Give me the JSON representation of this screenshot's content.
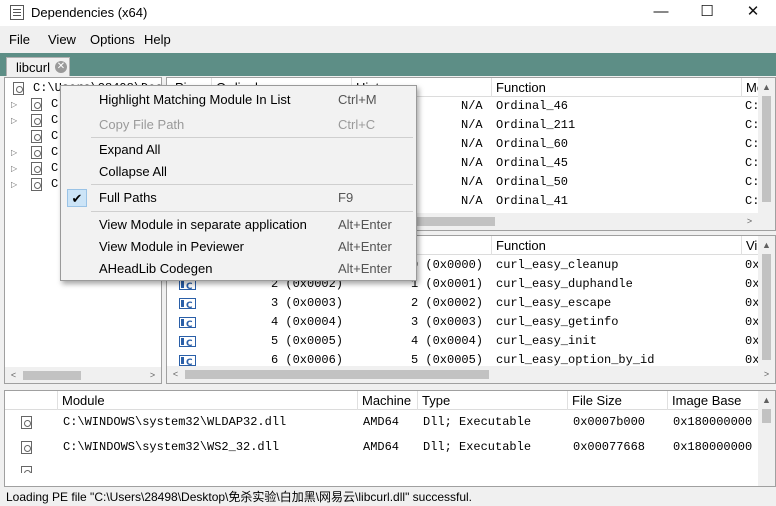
{
  "window": {
    "title": "Dependencies (x64)",
    "minimize_glyph": "—",
    "maximize_glyph": "☐",
    "close_glyph": "✕"
  },
  "menubar": {
    "items": [
      "File",
      "View",
      "Options",
      "Help"
    ]
  },
  "tab": {
    "label": "libcurl",
    "close_glyph": "✕"
  },
  "tree": {
    "root_label": "C:\\Users\\28498\\Desk",
    "child_labels": [
      "C",
      "C",
      "C",
      "C",
      "C",
      "C"
    ]
  },
  "imports": {
    "headers": {
      "pi": "Pi",
      "ordinal": "Ordinal",
      "hint": "Hint",
      "function": "Function",
      "module": "Mo"
    },
    "rows": [
      {
        "hint": "N/A",
        "function": "Ordinal_46",
        "module": "C:"
      },
      {
        "hint": "N/A",
        "function": "Ordinal_211",
        "module": "C:"
      },
      {
        "hint": "N/A",
        "function": "Ordinal_60",
        "module": "C:"
      },
      {
        "hint": "N/A",
        "function": "Ordinal_45",
        "module": "C:"
      },
      {
        "hint": "N/A",
        "function": "Ordinal_50",
        "module": "C:"
      },
      {
        "hint": "N/A",
        "function": "Ordinal_41",
        "module": "C:"
      }
    ]
  },
  "exports": {
    "headers": {
      "function": "Function",
      "virtual": "Vi"
    },
    "rows": [
      {
        "ordinal": "",
        "hint": "0 (0x0000)",
        "function": "curl_easy_cleanup",
        "virtual": "0x"
      },
      {
        "ordinal": "2 (0x0002)",
        "hint": "1 (0x0001)",
        "function": "curl_easy_duphandle",
        "virtual": "0x"
      },
      {
        "ordinal": "3 (0x0003)",
        "hint": "2 (0x0002)",
        "function": "curl_easy_escape",
        "virtual": "0x"
      },
      {
        "ordinal": "4 (0x0004)",
        "hint": "3 (0x0003)",
        "function": "curl_easy_getinfo",
        "virtual": "0x"
      },
      {
        "ordinal": "5 (0x0005)",
        "hint": "4 (0x0004)",
        "function": "curl_easy_init",
        "virtual": "0x"
      },
      {
        "ordinal": "6 (0x0006)",
        "hint": "5 (0x0005)",
        "function": "curl_easy_option_by_id",
        "virtual": "0x"
      }
    ]
  },
  "modules": {
    "headers": {
      "module": "Module",
      "machine": "Machine",
      "type": "Type",
      "file_size": "File Size",
      "image_base": "Image Base"
    },
    "rows": [
      {
        "module": "C:\\WINDOWS\\system32\\WLDAP32.dll",
        "machine": "AMD64",
        "type": "Dll; Executable",
        "file_size": "0x0007b000",
        "image_base": "0x180000000"
      },
      {
        "module": "C:\\WINDOWS\\system32\\WS2_32.dll",
        "machine": "AMD64",
        "type": "Dll; Executable",
        "file_size": "0x00077668",
        "image_base": "0x180000000"
      }
    ]
  },
  "context_menu": {
    "items": [
      {
        "label": "Highlight Matching Module In List",
        "shortcut": "Ctrl+M",
        "enabled": true,
        "checked": false
      },
      {
        "label": "Copy File Path",
        "shortcut": "Ctrl+C",
        "enabled": false,
        "checked": false
      },
      {
        "label": "Expand All",
        "shortcut": "",
        "enabled": true,
        "checked": false
      },
      {
        "label": "Collapse All",
        "shortcut": "",
        "enabled": true,
        "checked": false
      },
      {
        "label": "Full Paths",
        "shortcut": "F9",
        "enabled": true,
        "checked": true
      },
      {
        "label": "View Module in separate application",
        "shortcut": "Alt+Enter",
        "enabled": true,
        "checked": false
      },
      {
        "label": "View Module in Peviewer",
        "shortcut": "Alt+Enter",
        "enabled": true,
        "checked": false
      },
      {
        "label": "AHeadLib Codegen",
        "shortcut": "Alt+Enter",
        "enabled": true,
        "checked": false
      }
    ],
    "check_glyph": "✔"
  },
  "status": {
    "text": "Loading PE file \"C:\\Users\\28498\\Desktop\\免杀实验\\白加黑\\网易云\\libcurl.dll\" successful."
  }
}
